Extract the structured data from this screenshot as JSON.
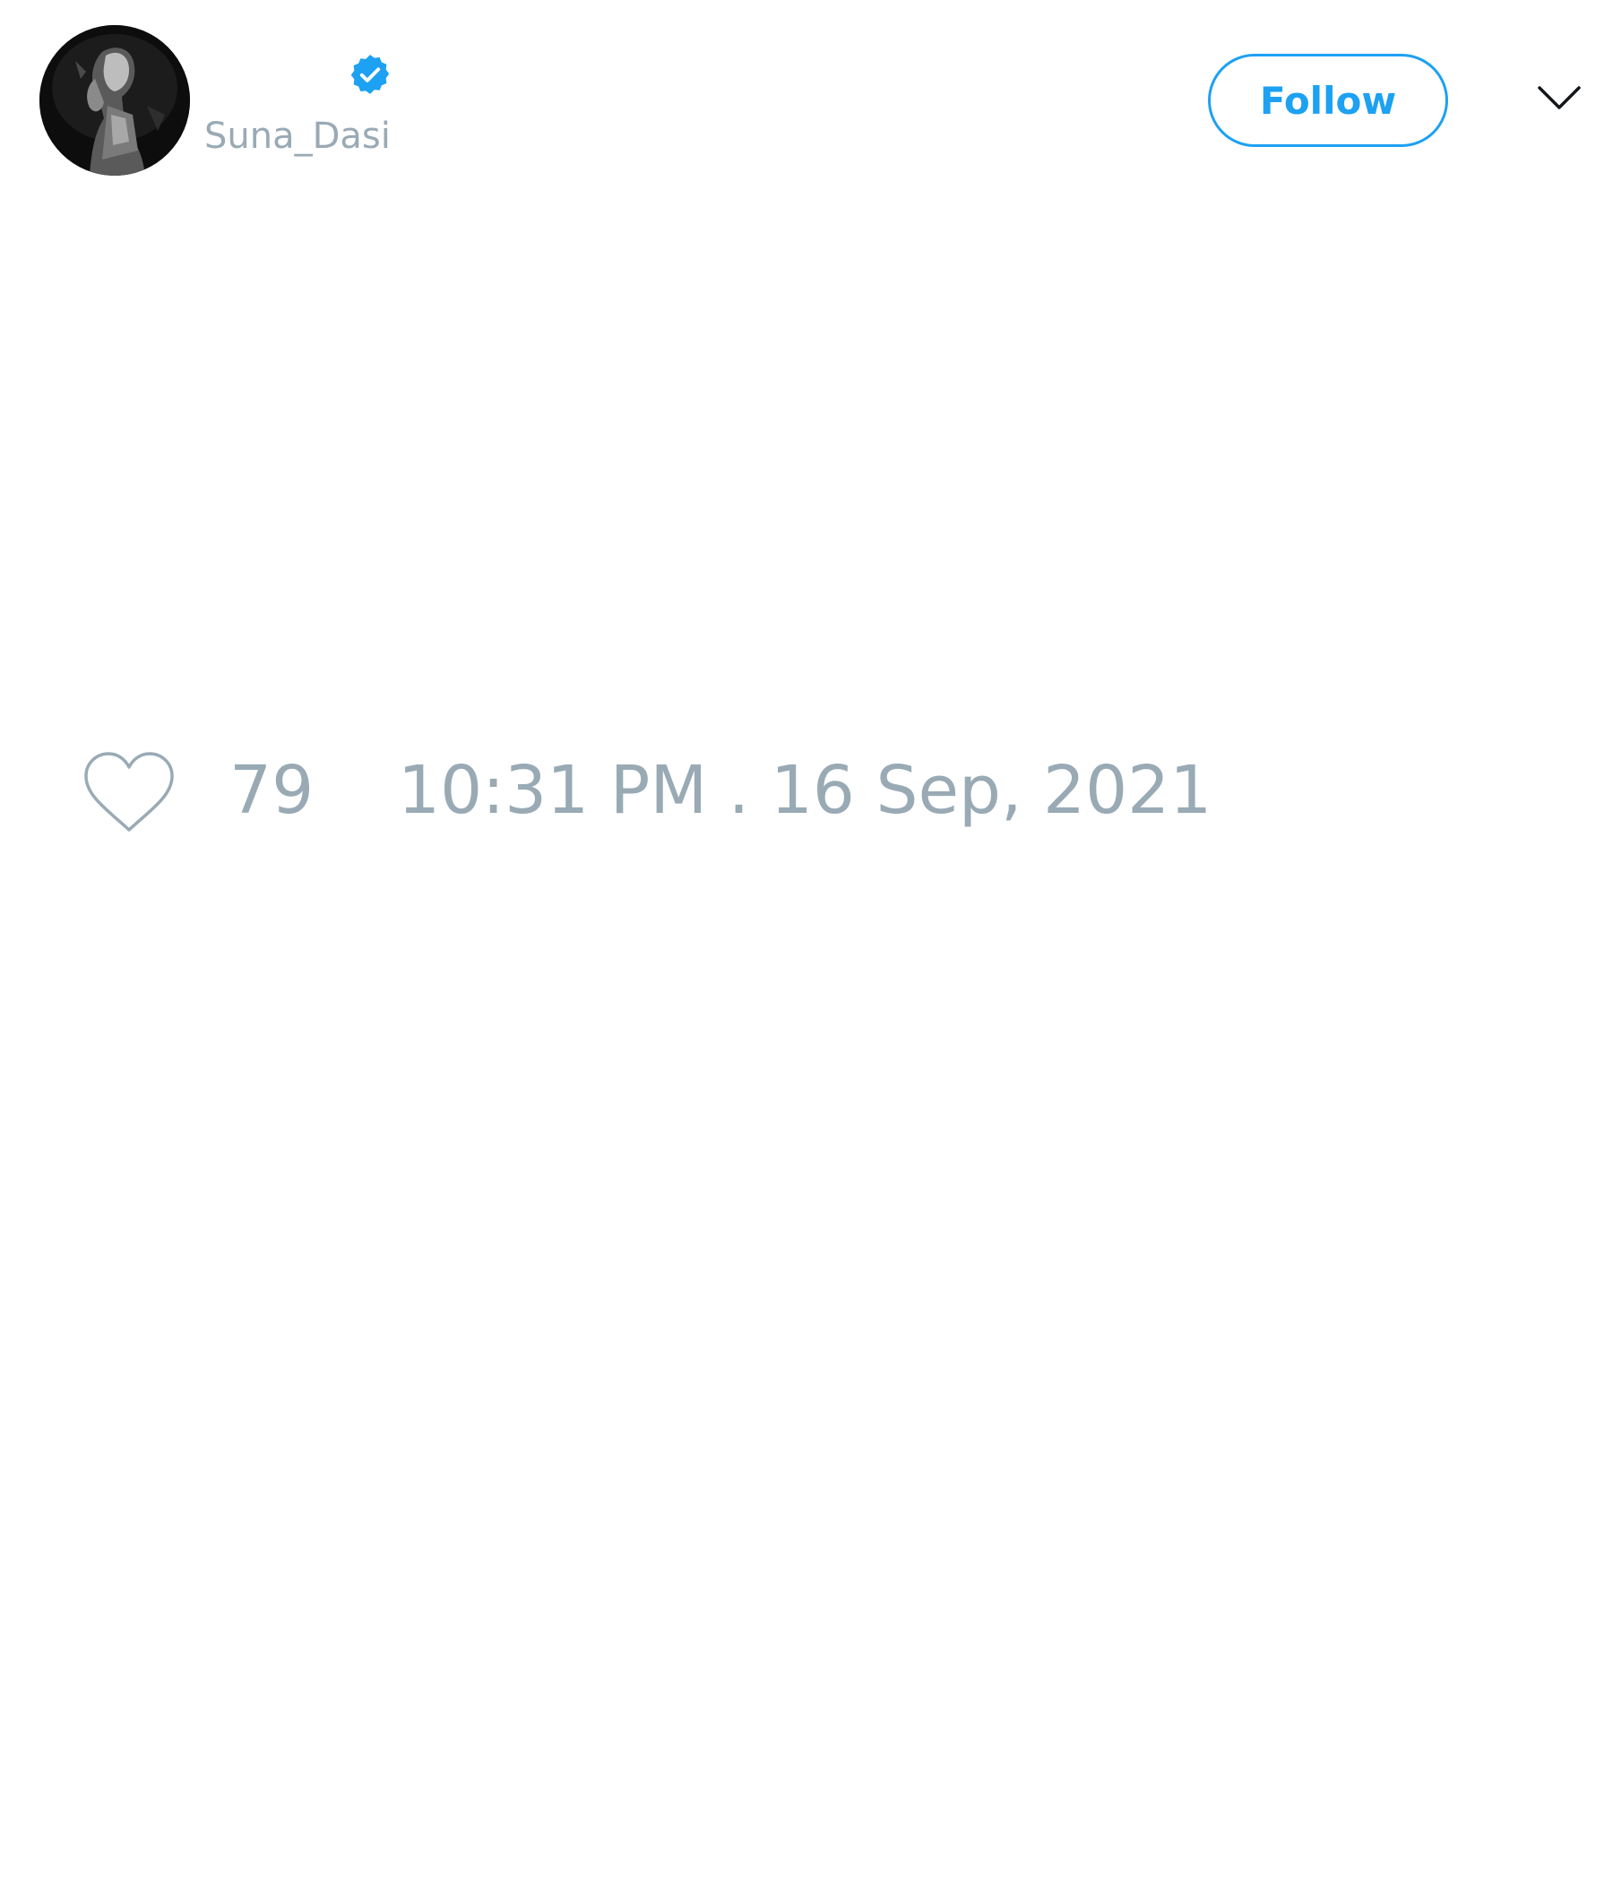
{
  "tweet": {
    "author": {
      "display_name": "",
      "handle": "Suna_Dasi",
      "verified": true,
      "avatar_icon": "profile-photo"
    },
    "follow_label": "Follow",
    "menu_icon": "chevron-down-icon",
    "likes": {
      "icon": "heart-icon",
      "count": "79"
    },
    "timestamp": "10:31 PM . 16 Sep, 2021"
  },
  "colors": {
    "accent": "#1da1f2",
    "muted_text": "#99aab5",
    "background": "#ffffff"
  }
}
